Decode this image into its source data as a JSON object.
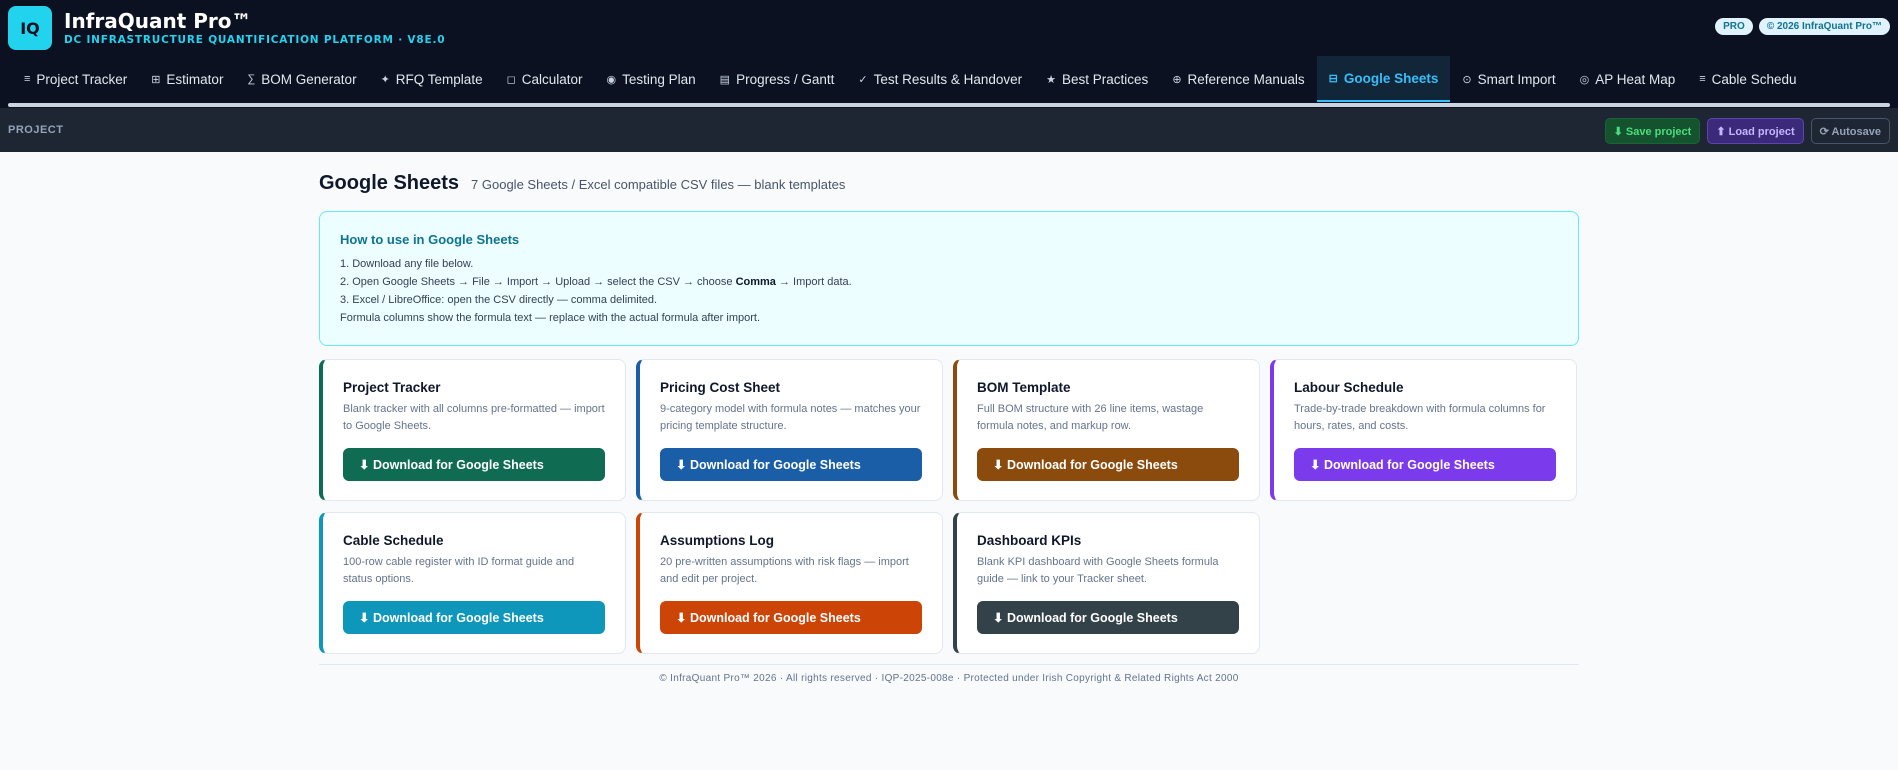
{
  "header": {
    "logo_text": "IQ",
    "title": "InfraQuant Pro™",
    "subtitle": "DC INFRASTRUCTURE QUANTIFICATION PLATFORM · V8E.0",
    "badge_pro": "PRO",
    "badge_copyright": "© 2026 InfraQuant Pro™"
  },
  "nav": {
    "tabs": [
      {
        "icon": "≡",
        "label": "Project Tracker"
      },
      {
        "icon": "⊞",
        "label": "Estimator"
      },
      {
        "icon": "∑",
        "label": "BOM Generator"
      },
      {
        "icon": "✦",
        "label": "RFQ Template"
      },
      {
        "icon": "◻",
        "label": "Calculator"
      },
      {
        "icon": "◉",
        "label": "Testing Plan"
      },
      {
        "icon": "▤",
        "label": "Progress / Gantt"
      },
      {
        "icon": "✓",
        "label": "Test Results & Handover"
      },
      {
        "icon": "★",
        "label": "Best Practices"
      },
      {
        "icon": "⊕",
        "label": "Reference Manuals"
      },
      {
        "icon": "⊟",
        "label": "Google Sheets"
      },
      {
        "icon": "⊙",
        "label": "Smart Import"
      },
      {
        "icon": "◎",
        "label": "AP Heat Map"
      },
      {
        "icon": "≡",
        "label": "Cable Schedu"
      }
    ],
    "active_index": 10
  },
  "project_bar": {
    "label": "PROJECT",
    "save_label": "⬇ Save project",
    "load_label": "⬆ Load project",
    "autosave_label": "⟳ Autosave"
  },
  "main": {
    "title": "Google Sheets",
    "subtitle": "7 Google Sheets / Excel compatible CSV files — blank templates",
    "howto": {
      "title": "How to use in Google Sheets",
      "line1": "1. Download any file below.",
      "line2_pre": "2. Open Google Sheets → File → Import → Upload → select the CSV → choose ",
      "line2_bold": "Comma",
      "line2_post": " → Import data.",
      "line3": "3. Excel / LibreOffice: open the CSV directly — comma delimited.",
      "line4": "Formula columns show the formula text — replace with the actual formula after import."
    },
    "cards": [
      {
        "title": "Project Tracker",
        "desc": "Blank tracker with all columns pre-formatted — import to Google Sheets.",
        "button": "⬇ Download for Google Sheets",
        "color": "#0f6b52"
      },
      {
        "title": "Pricing Cost Sheet",
        "desc": "9-category model with formula notes — matches your pricing template structure.",
        "button": "⬇ Download for Google Sheets",
        "color": "#1a5ea8"
      },
      {
        "title": "BOM Template",
        "desc": "Full BOM structure with 26 line items, wastage formula notes, and markup row.",
        "button": "⬇ Download for Google Sheets",
        "color": "#8a4b0c"
      },
      {
        "title": "Labour Schedule",
        "desc": "Trade-by-trade breakdown with formula columns for hours, rates, and costs.",
        "button": "⬇ Download for Google Sheets",
        "color": "#7c3aed"
      },
      {
        "title": "Cable Schedule",
        "desc": "100-row cable register with ID format guide and status options.",
        "button": "⬇ Download for Google Sheets",
        "color": "#0e97bb"
      },
      {
        "title": "Assumptions Log",
        "desc": "20 pre-written assumptions with risk flags — import and edit per project.",
        "button": "⬇ Download for Google Sheets",
        "color": "#cc4406"
      },
      {
        "title": "Dashboard KPIs",
        "desc": "Blank KPI dashboard with Google Sheets formula guide — link to your Tracker sheet.",
        "button": "⬇ Download for Google Sheets",
        "color": "#334148"
      }
    ]
  },
  "footer": {
    "text": "© InfraQuant Pro™ 2026 · All rights reserved · IQP-2025-008e · Protected under Irish Copyright & Related Rights Act 2000"
  }
}
